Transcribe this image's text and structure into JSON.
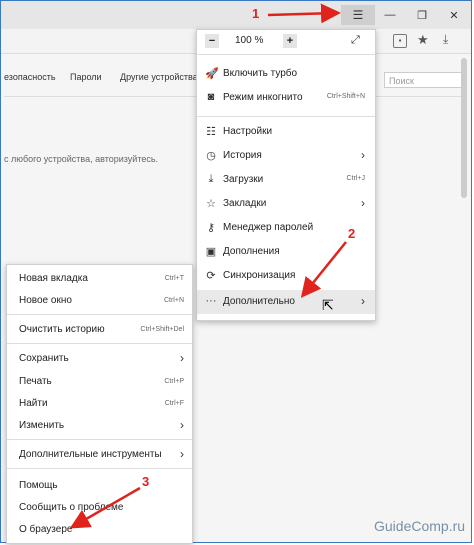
{
  "window": {
    "menu_icon": "hamburger-icon",
    "minimize_glyph": "—",
    "restore_glyph": "❐",
    "close_glyph": "✕"
  },
  "addressbar": {
    "icons": [
      "page-icon",
      "star-icon",
      "download-icon"
    ]
  },
  "settings": {
    "tabs": [
      "езопасность",
      "Пароли",
      "Другие устройства"
    ],
    "search_placeholder": "Поиск",
    "sync_text": "с любого устройства, авторизуйтесь."
  },
  "main_menu": {
    "zoom_minus": "−",
    "zoom_value": "100 %",
    "zoom_plus": "+",
    "items": [
      {
        "icon": "rocket-icon",
        "label": "Включить турбо",
        "shortcut": "",
        "arrow": ""
      },
      {
        "icon": "incognito-icon",
        "label": "Режим инкогнито",
        "shortcut": "Ctrl+Shift+N",
        "arrow": ""
      },
      {
        "icon": "settings-icon",
        "label": "Настройки",
        "shortcut": "",
        "arrow": ""
      },
      {
        "icon": "history-icon",
        "label": "История",
        "shortcut": "",
        "arrow": "›"
      },
      {
        "icon": "download-icon",
        "label": "Загрузки",
        "shortcut": "Ctrl+J",
        "arrow": ""
      },
      {
        "icon": "star-icon",
        "label": "Закладки",
        "shortcut": "",
        "arrow": "›"
      },
      {
        "icon": "key-icon",
        "label": "Менеджер паролей",
        "shortcut": "",
        "arrow": ""
      },
      {
        "icon": "puzzle-icon",
        "label": "Дополнения",
        "shortcut": "",
        "arrow": ""
      },
      {
        "icon": "sync-icon",
        "label": "Синхронизация",
        "shortcut": "",
        "arrow": ""
      },
      {
        "icon": "more-icon",
        "label": "Дополнительно",
        "shortcut": "",
        "arrow": "›"
      }
    ]
  },
  "sub_menu": {
    "items": [
      {
        "label": "Новая вкладка",
        "shortcut": "Ctrl+T",
        "arrow": ""
      },
      {
        "label": "Новое окно",
        "shortcut": "Ctrl+N",
        "arrow": ""
      },
      {
        "label": "Очистить историю",
        "shortcut": "Ctrl+Shift+Del",
        "arrow": ""
      },
      {
        "label": "Сохранить",
        "shortcut": "",
        "arrow": "›"
      },
      {
        "label": "Печать",
        "shortcut": "Ctrl+P",
        "arrow": ""
      },
      {
        "label": "Найти",
        "shortcut": "Ctrl+F",
        "arrow": ""
      },
      {
        "label": "Изменить",
        "shortcut": "",
        "arrow": "›"
      },
      {
        "label": "Дополнительные инструменты",
        "shortcut": "",
        "arrow": "›"
      },
      {
        "label": "Помощь",
        "shortcut": "",
        "arrow": ""
      },
      {
        "label": "Сообщить о проблеме",
        "shortcut": "",
        "arrow": ""
      },
      {
        "label": "О браузере",
        "shortcut": "",
        "arrow": ""
      }
    ]
  },
  "annotations": {
    "step1": "1",
    "step2": "2",
    "step3": "3",
    "color": "#e0231c"
  },
  "watermark": "GuideComp.ru"
}
